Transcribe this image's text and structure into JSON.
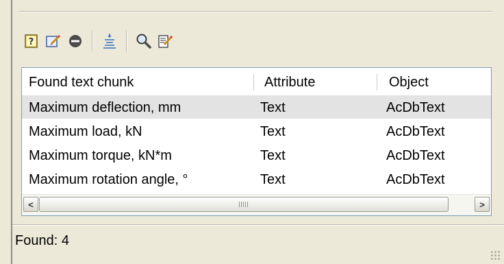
{
  "toolbar": {
    "buttons": [
      {
        "icon": "help-icon"
      },
      {
        "icon": "edit-icon"
      },
      {
        "icon": "remove-icon"
      },
      {
        "icon": "align-icon"
      },
      {
        "icon": "search-icon"
      },
      {
        "icon": "edit-document-icon"
      }
    ]
  },
  "grid": {
    "columns": [
      "Found text chunk",
      "Attribute",
      "Object"
    ],
    "rows": [
      [
        "Maximum deflection, mm",
        "Text",
        "AcDbText"
      ],
      [
        "Maximum load, kN",
        "Text",
        "AcDbText"
      ],
      [
        "Maximum torque, kN*m",
        "Text",
        "AcDbText"
      ],
      [
        "Maximum rotation angle, °",
        "Text",
        "AcDbText"
      ]
    ],
    "selected_row": 0
  },
  "scrollbar": {
    "left_arrow": "<",
    "right_arrow": ">"
  },
  "status": {
    "text": "Found: 4"
  },
  "colors": {
    "background": "#ece9d8",
    "grid_border": "#7f9db9",
    "selected_row": "#e3e3e3"
  }
}
